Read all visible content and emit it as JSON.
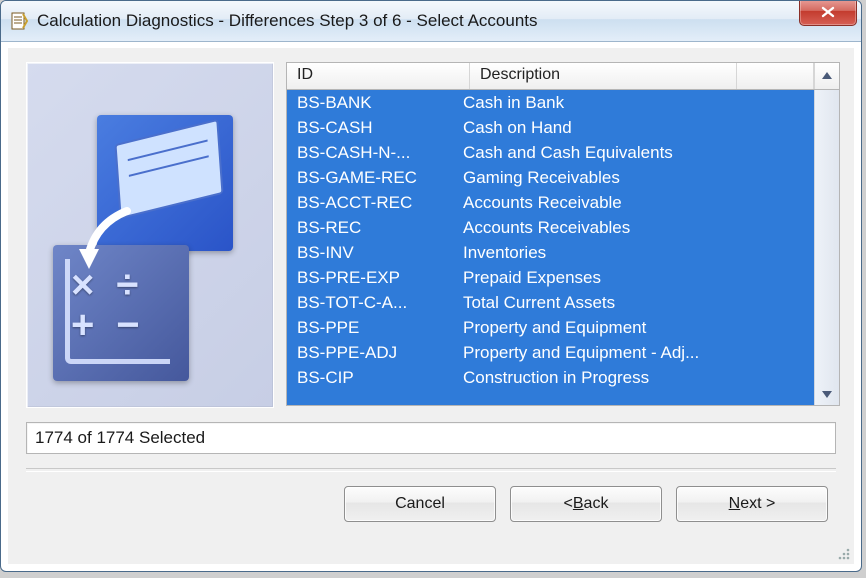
{
  "window": {
    "title": "Calculation Diagnostics - Differences Step 3 of 6 - Select Accounts"
  },
  "columns": {
    "id": "ID",
    "description": "Description"
  },
  "rows": [
    {
      "id": "BS-BANK",
      "desc": "Cash in Bank"
    },
    {
      "id": "BS-CASH",
      "desc": "Cash on Hand"
    },
    {
      "id": "BS-CASH-N-...",
      "desc": "Cash and Cash Equivalents"
    },
    {
      "id": "BS-GAME-REC",
      "desc": "Gaming Receivables"
    },
    {
      "id": "BS-ACCT-REC",
      "desc": "Accounts Receivable"
    },
    {
      "id": "BS-REC",
      "desc": "Accounts Receivables"
    },
    {
      "id": "BS-INV",
      "desc": "Inventories"
    },
    {
      "id": "BS-PRE-EXP",
      "desc": "Prepaid Expenses"
    },
    {
      "id": "BS-TOT-C-A...",
      "desc": "Total Current Assets"
    },
    {
      "id": "BS-PPE",
      "desc": "Property and Equipment"
    },
    {
      "id": "BS-PPE-ADJ",
      "desc": "Property and Equipment - Adj..."
    },
    {
      "id": "BS-CIP",
      "desc": "Construction in Progress"
    }
  ],
  "status": {
    "text": "1774 of 1774 Selected",
    "selected": 1774,
    "total": 1774
  },
  "buttons": {
    "cancel": "Cancel",
    "back_prefix": "< ",
    "back_u": "B",
    "back_suffix": "ack",
    "next_u": "N",
    "next_suffix": "ext >"
  }
}
